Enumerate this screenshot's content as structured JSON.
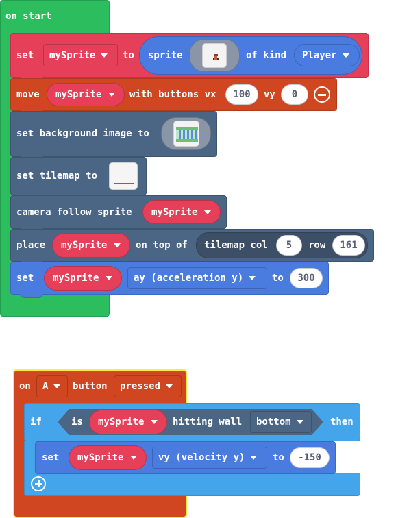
{
  "colors": {
    "events": "#2bbd5e",
    "sprites": "#e63f59",
    "controller": "#cf4621",
    "scene": "#4b6584",
    "scene_dark": "#3d4f66",
    "physics": "#4a7ce0",
    "logic": "#45a5eb",
    "if_hex": "#4b6584"
  },
  "on_start": {
    "label": "on start",
    "set_sprite": {
      "set": "set",
      "variable": "mySprite",
      "to": "to",
      "sprite": "sprite",
      "of_kind": "of kind",
      "kind": "Player",
      "icon": "sprite-image-icon"
    },
    "move": {
      "move": "move",
      "variable": "mySprite",
      "with_buttons": "with buttons vx",
      "vx": "100",
      "vy_label": "vy",
      "vy": "0",
      "icon": "minus-circle-icon"
    },
    "background": {
      "label": "set background image to",
      "icon": "background-image-icon"
    },
    "tilemap": {
      "label": "set tilemap to",
      "icon": "tilemap-image-icon"
    },
    "camera": {
      "label": "camera follow sprite",
      "variable": "mySprite"
    },
    "place": {
      "place": "place",
      "variable": "mySprite",
      "on_top_of": "on top of",
      "tilemap_col": "tilemap col",
      "col": "5",
      "row_label": "row",
      "row": "161"
    },
    "set_ay": {
      "set": "set",
      "variable": "mySprite",
      "property": "ay (acceleration y)",
      "to": "to",
      "value": "300"
    }
  },
  "on_button": {
    "on": "on",
    "button_name": "A",
    "button": "button",
    "event": "pressed",
    "if": "if",
    "is": "is",
    "variable": "mySprite",
    "hitting_wall": "hitting wall",
    "direction": "bottom",
    "then": "then",
    "set_vy": {
      "set": "set",
      "variable": "mySprite",
      "property": "vy (velocity y)",
      "to": "to",
      "value": "-150"
    },
    "add_icon": "plus-circle-icon"
  }
}
